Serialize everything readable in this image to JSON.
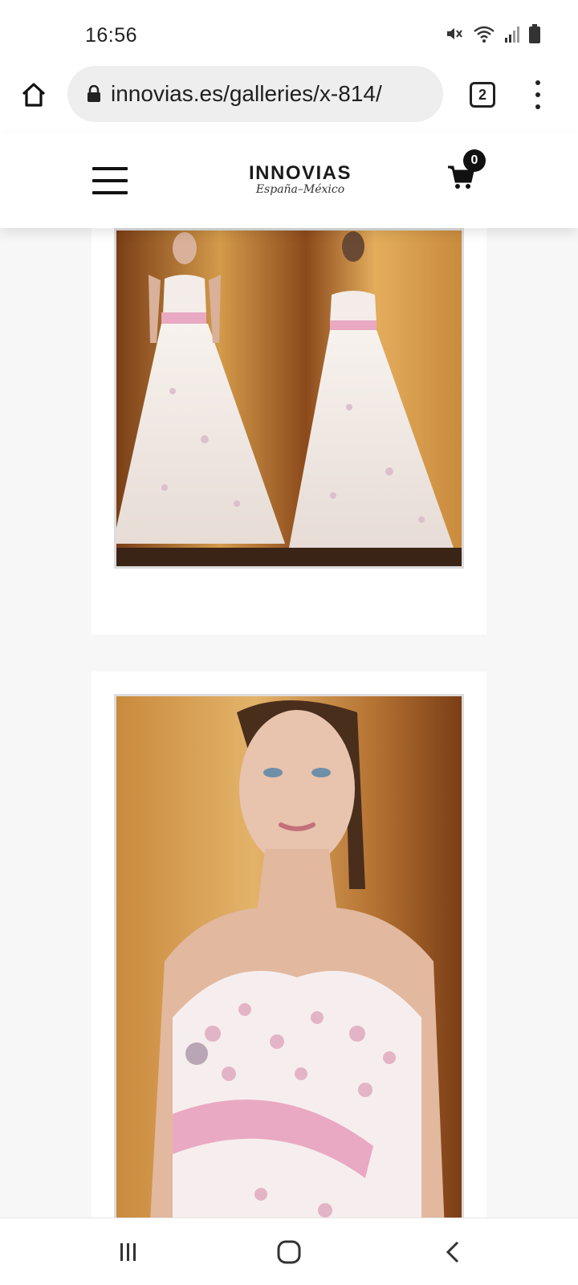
{
  "status_bar": {
    "time": "16:56",
    "icons": [
      "mute-vibrate-icon",
      "wifi-icon",
      "signal-icon",
      "battery-icon"
    ]
  },
  "browser": {
    "url": "innovias.es/galleries/x-814/",
    "tab_count": "2"
  },
  "site_header": {
    "logo_main": "INNOVIAS",
    "logo_sub": "España–México",
    "cart_count": "0"
  },
  "gallery": {
    "images": [
      {
        "name": "dress-full-length-front-back"
      },
      {
        "name": "dress-bodice-closeup"
      }
    ]
  },
  "colors": {
    "sash_pink": "#e9a9c2",
    "wall_wood": "#d39a4a",
    "badge": "#111111"
  }
}
